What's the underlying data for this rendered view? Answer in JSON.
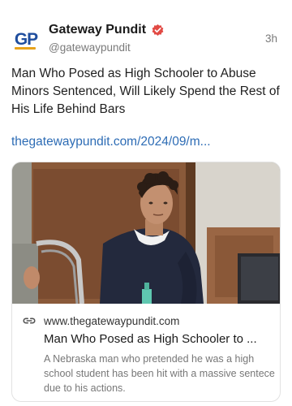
{
  "header": {
    "avatar_icon": "gateway-pundit-logo",
    "name": "Gateway Pundit",
    "handle": "@gatewaypundit",
    "time": "3h",
    "verified_icon": "verified-badge-icon",
    "verified_color": "#e24a44"
  },
  "post": {
    "text": "Man Who Posed as High Schooler to Abuse Minors Sentenced, Will Likely Spend the Rest of His Life Behind Bars",
    "link_text": "thegatewaypundit.com/2024/09/m...",
    "link_color": "#2d6cb5"
  },
  "card": {
    "link_icon": "link-icon",
    "domain": "www.thegatewaypundit.com",
    "title": "Man Who Posed as High Schooler to ...",
    "description": "A Nebraska man who pretended he was a high school student has been hit with a massive sentece due to his actions."
  }
}
